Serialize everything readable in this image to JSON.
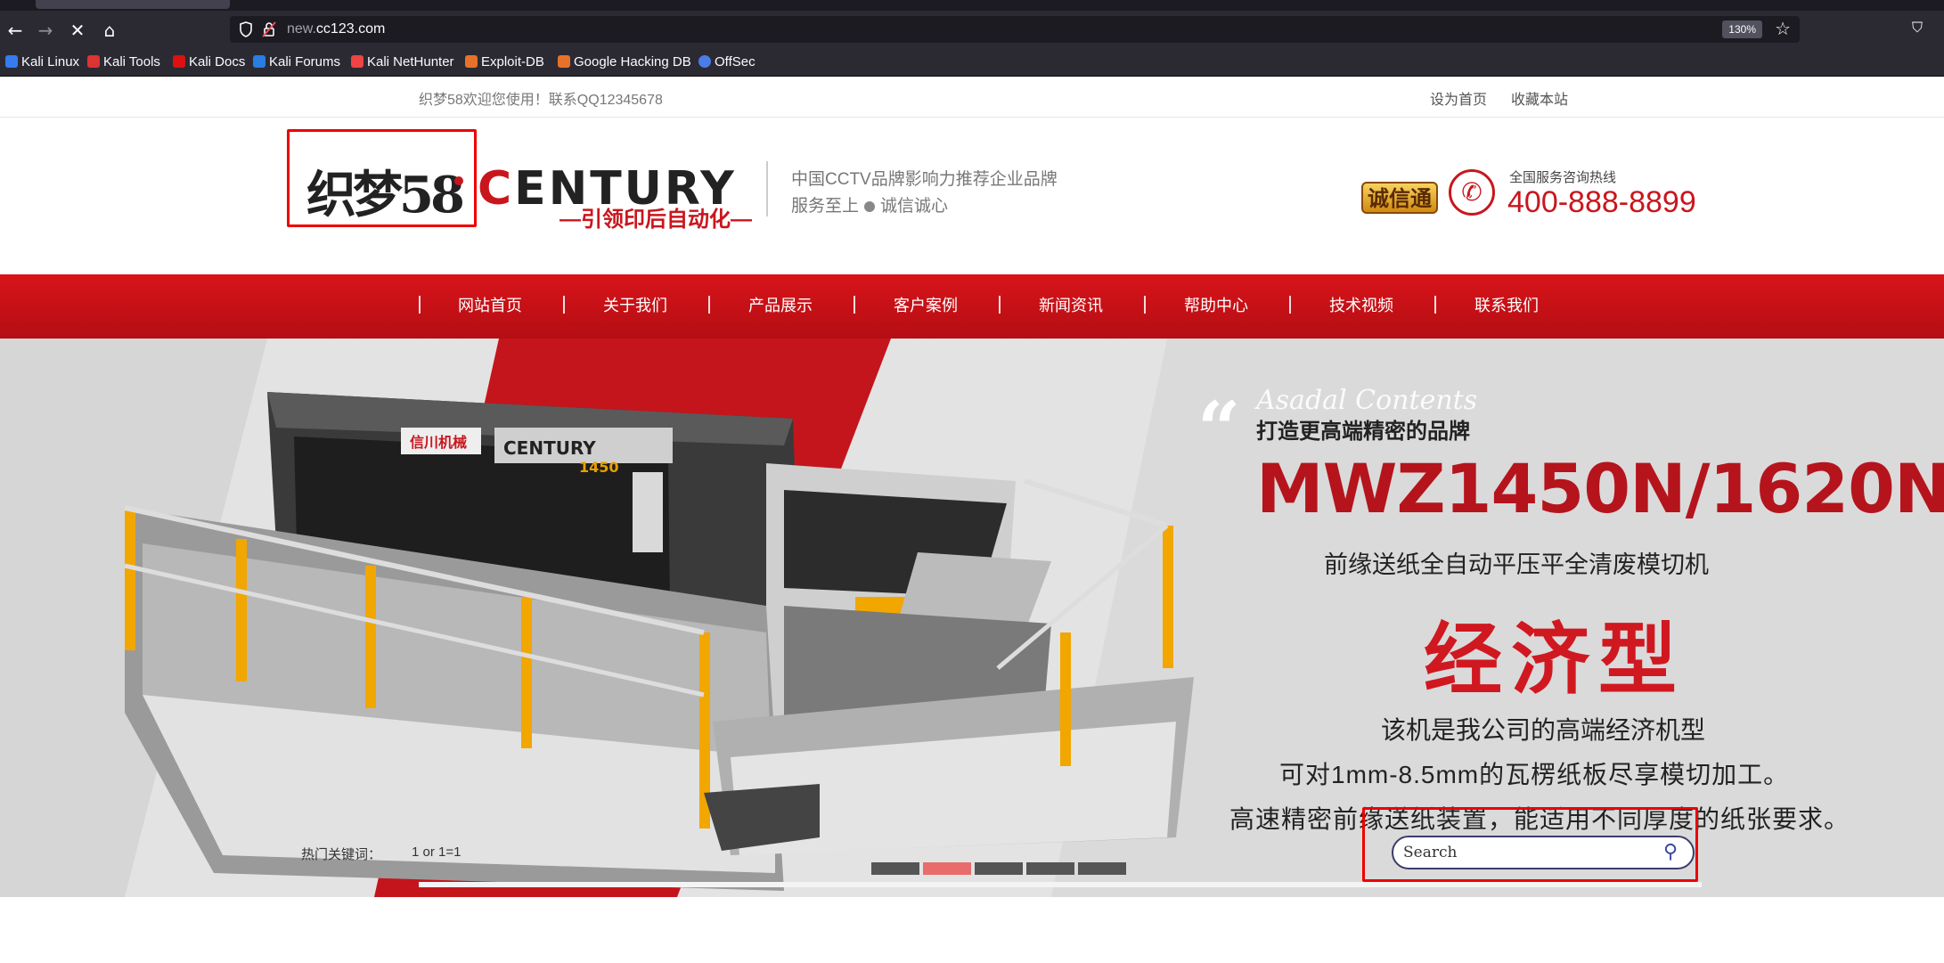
{
  "browser": {
    "url_prefix": "new.",
    "url_host": "cc123.com",
    "zoom": "130%",
    "bookmarks": [
      {
        "label": "Kali Linux",
        "icon": "kali-icon",
        "color": "#367bf0"
      },
      {
        "label": "Kali Tools",
        "icon": "kali-tools-icon",
        "color": "#d33"
      },
      {
        "label": "Kali Docs",
        "icon": "kali-docs-icon",
        "color": "#d11"
      },
      {
        "label": "Kali Forums",
        "icon": "kali-forums-icon",
        "color": "#2a7de1"
      },
      {
        "label": "Kali NetHunter",
        "icon": "nethunter-icon",
        "color": "#e44"
      },
      {
        "label": "Exploit-DB",
        "icon": "exploit-db-icon",
        "color": "#e8712a"
      },
      {
        "label": "Google Hacking DB",
        "icon": "ghdb-icon",
        "color": "#e8712a"
      },
      {
        "label": "OffSec",
        "icon": "offsec-icon",
        "color": "#4a7de8"
      }
    ]
  },
  "topbar": {
    "welcome": "织梦58欢迎您使用！联系QQ12345678",
    "set_home": "设为首页",
    "bookmark_site": "收藏本站"
  },
  "header": {
    "logo_cn": "织梦58",
    "logo_en_c": "C",
    "logo_en_rest": "ENTURY",
    "logo_sub": "—引领印后自动化—",
    "slogan1": "中国CCTV品牌影响力推荐企业品牌",
    "slogan2_a": "服务至上",
    "slogan2_b": "诚信诚心",
    "badge": "诚信通",
    "hotline_label": "全国服务咨询热线",
    "hotline": "400-888-8899"
  },
  "nav": [
    "网站首页",
    "关于我们",
    "产品展示",
    "客户案例",
    "新闻资讯",
    "帮助中心",
    "技术视频",
    "联系我们"
  ],
  "banner": {
    "script_text": "Asadal Contents",
    "tag": "打造更高端精密的品牌",
    "model": "MWZ1450N/1620N",
    "subtitle": "前缘送纸全自动平压平全清废模切机",
    "type": "经济型",
    "line1": "该机是我公司的高端经济机型",
    "line2": "可对1mm-8.5mm的瓦楞纸板尽享模切加工。",
    "line3": "高速精密前缘送纸装置，能适用不同厚度的纸张要求。",
    "machine_brand": "信川机械",
    "machine_model": "CENTURY",
    "machine_num": "1450",
    "slides": 5,
    "active_slide": 2
  },
  "search": {
    "hot_label": "热门关键词：",
    "hot_word": "1 or 1=1",
    "placeholder": "Search"
  },
  "colors": {
    "brand_red": "#c9161d",
    "nav_red": "#d8141a",
    "highlight": "#ee0000"
  }
}
